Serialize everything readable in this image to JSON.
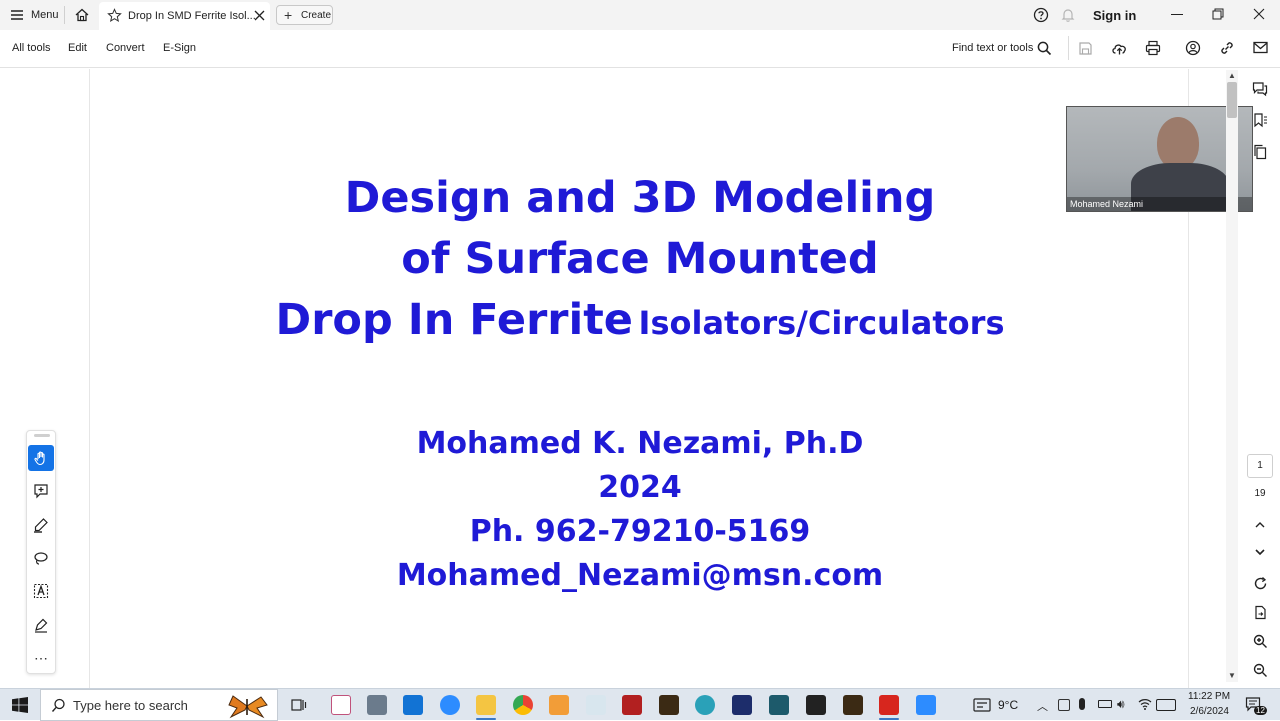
{
  "titlebar": {
    "menu_label": "Menu",
    "tab_title": "Drop In SMD Ferrite Isol...",
    "create_label": "Create",
    "sign_in": "Sign in"
  },
  "toolbar": {
    "all_tools": "All tools",
    "edit": "Edit",
    "convert": "Convert",
    "esign": "E-Sign",
    "find": "Find text or tools"
  },
  "document": {
    "title_line1": "Design and 3D Modeling",
    "title_line2": "of Surface Mounted",
    "title_line3_big": "Drop In Ferrite",
    "title_line3_small": "Isolators/Circulators",
    "author": "Mohamed K. Nezami, Ph.D",
    "year": "2024",
    "phone": "Ph. 962-79210-5169",
    "email": "Mohamed_Nezami@msn.com"
  },
  "video": {
    "participant_name": "Mohamed Nezami"
  },
  "page_nav": {
    "current_page": "1",
    "total_pages": "19"
  },
  "taskbar": {
    "search_placeholder": "Type here to search",
    "temperature": "9°C",
    "time": "11:22 PM",
    "date": "2/6/2024",
    "notification_count": "12"
  },
  "colors": {
    "title_blue": "#1f1ad6",
    "hand_tool_active": "#1473e6"
  }
}
